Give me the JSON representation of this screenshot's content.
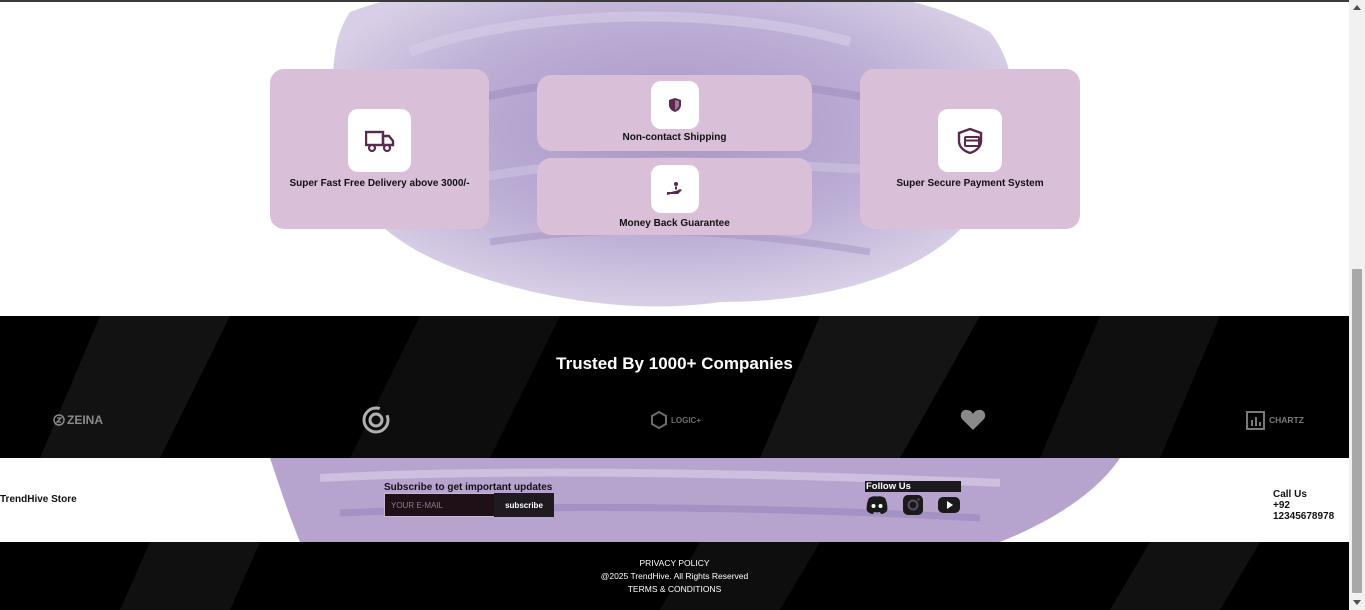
{
  "features": {
    "card_delivery": {
      "label": "Super Fast Free Delivery above 3000/-",
      "icon": "truck-icon"
    },
    "card_shipping": {
      "label": "Non-contact Shipping",
      "icon": "shield-icon"
    },
    "card_money": {
      "label": "Money Back Guarantee",
      "icon": "hand-coin-icon"
    },
    "card_payment": {
      "label": "Super Secure Payment System",
      "icon": "secure-card-icon"
    }
  },
  "trusted": {
    "title": "Trusted By 1000+ Companies",
    "logos": [
      {
        "name": "ZEINA",
        "icon": "zeina-logo"
      },
      {
        "name": "",
        "icon": "spiral-logo"
      },
      {
        "name": "LOGIC+",
        "icon": "logic-logo"
      },
      {
        "name": "",
        "icon": "heart-logo"
      },
      {
        "name": "CHARTZ",
        "icon": "chartz-logo"
      }
    ]
  },
  "subscribe": {
    "store_name": "TrendHive Store",
    "title": "Subscribe to get important updates",
    "email_placeholder": "YOUR E-MAIL",
    "button_label": "subscribe",
    "follow_title": "Follow Us",
    "social": [
      "discord-icon",
      "instagram-icon",
      "youtube-icon"
    ],
    "call_label": "Call Us",
    "phone": "+92 12345678978"
  },
  "footer": {
    "privacy": "PRIVACY POLICY",
    "copyright": "@2025 TrendHive. All Rights Reserved",
    "terms": "TERMS & CONDITIONS"
  },
  "colors": {
    "card_bg": "#d9bfd7",
    "icon_color": "#5a2a4e",
    "paint": "#b7a5cf",
    "dark": "#000000"
  }
}
